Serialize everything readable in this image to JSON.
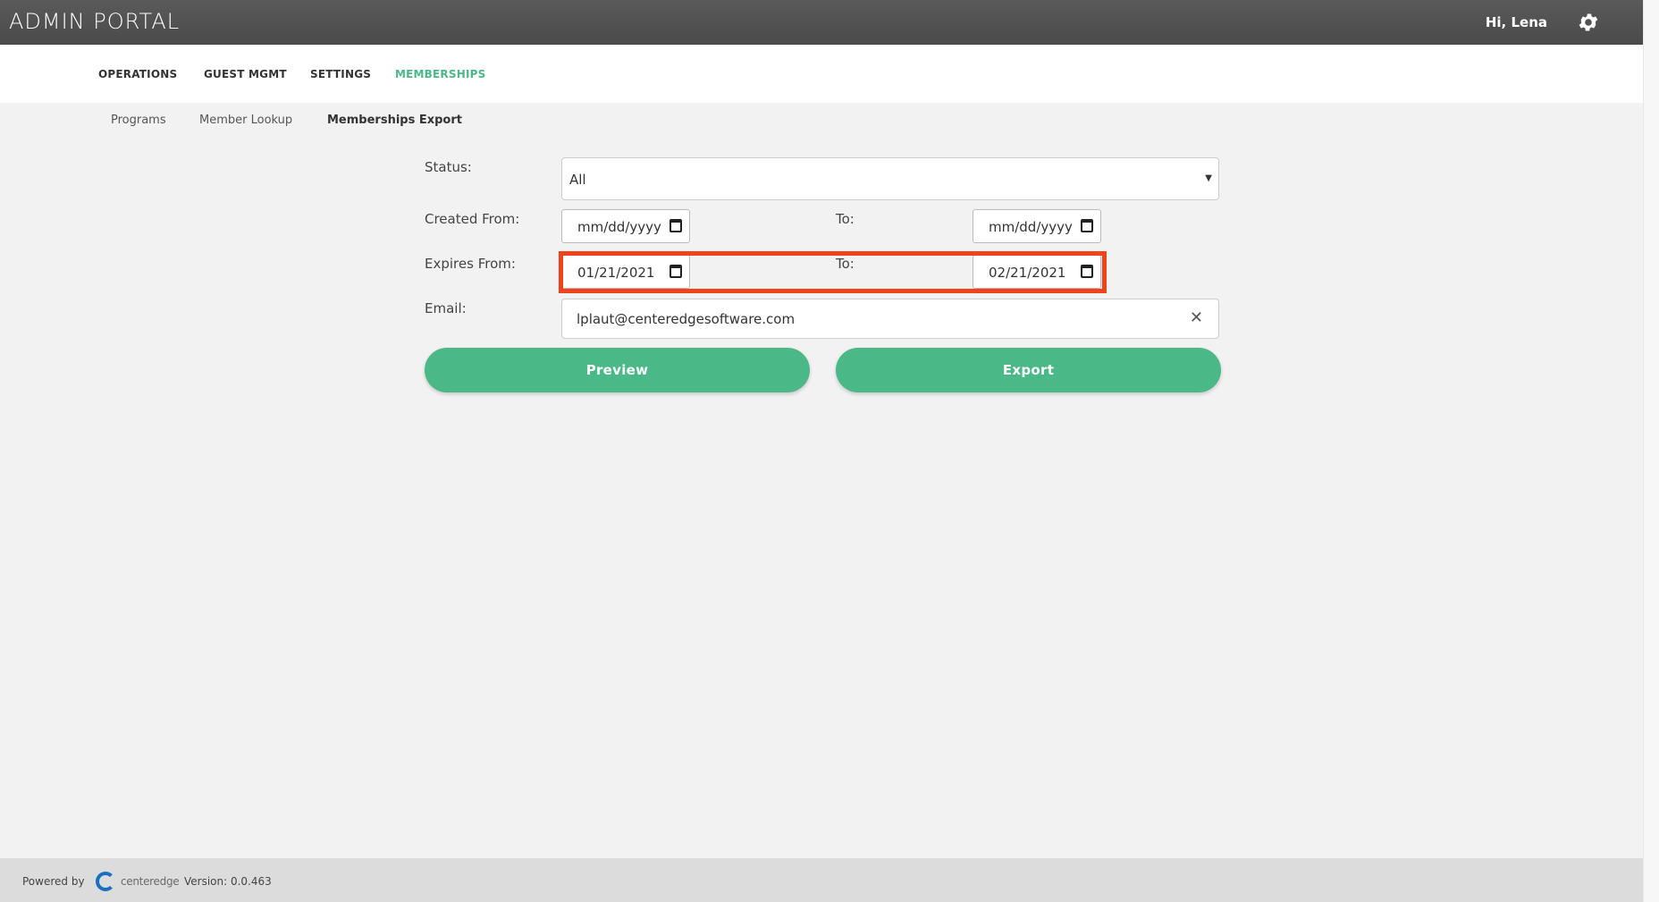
{
  "header": {
    "title": "ADMIN PORTAL",
    "greeting": "Hi, Lena",
    "settings_icon": "gear-icon"
  },
  "nav": {
    "items": [
      {
        "label": "OPERATIONS",
        "active": false
      },
      {
        "label": "GUEST MGMT",
        "active": false
      },
      {
        "label": "SETTINGS",
        "active": false
      },
      {
        "label": "MEMBERSHIPS",
        "active": true
      }
    ]
  },
  "subnav": {
    "items": [
      {
        "label": "Programs",
        "active": false
      },
      {
        "label": "Member Lookup",
        "active": false
      },
      {
        "label": "Memberships Export",
        "active": true
      }
    ]
  },
  "form": {
    "status_label": "Status:",
    "status_value": "All",
    "created_from_label": "Created From:",
    "created_from_value": "mm/dd/yyyy",
    "created_to_label": "To:",
    "created_to_value": "mm/dd/yyyy",
    "expires_from_label": "Expires From:",
    "expires_from_value": "01/21/2021",
    "expires_to_label": "To:",
    "expires_to_value": "02/21/2021",
    "email_label": "Email:",
    "email_value": "lplaut@centeredgesoftware.com",
    "clear_symbol": "✕",
    "preview_label": "Preview",
    "export_label": "Export"
  },
  "footer": {
    "powered_by": "Powered by",
    "logo_text": "centeredge",
    "version": "Version: 0.0.463"
  },
  "colors": {
    "accent": "#4ab887",
    "highlight": "#f0431c",
    "topbar": "#4f4f4f"
  }
}
